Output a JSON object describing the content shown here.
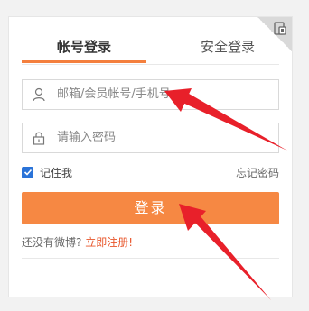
{
  "tabs": {
    "account": "帐号登录",
    "secure": "安全登录"
  },
  "username": {
    "placeholder": "邮箱/会员帐号/手机号"
  },
  "password": {
    "placeholder": "请输入密码"
  },
  "remember": {
    "label": "记住我",
    "checked": true
  },
  "forgot": "忘记密码",
  "login_button": "登录",
  "register": {
    "prefix": "还没有微博?",
    "link": "立即注册!"
  },
  "colors": {
    "accent": "#f68843",
    "tab_underline": "#f47f3d",
    "link": "#e8552a",
    "arrow": "#e8202a",
    "checkbox": "#2a73d8"
  },
  "icons": {
    "corner": "qr-switch-icon",
    "user": "user-icon",
    "lock": "lock-icon"
  }
}
